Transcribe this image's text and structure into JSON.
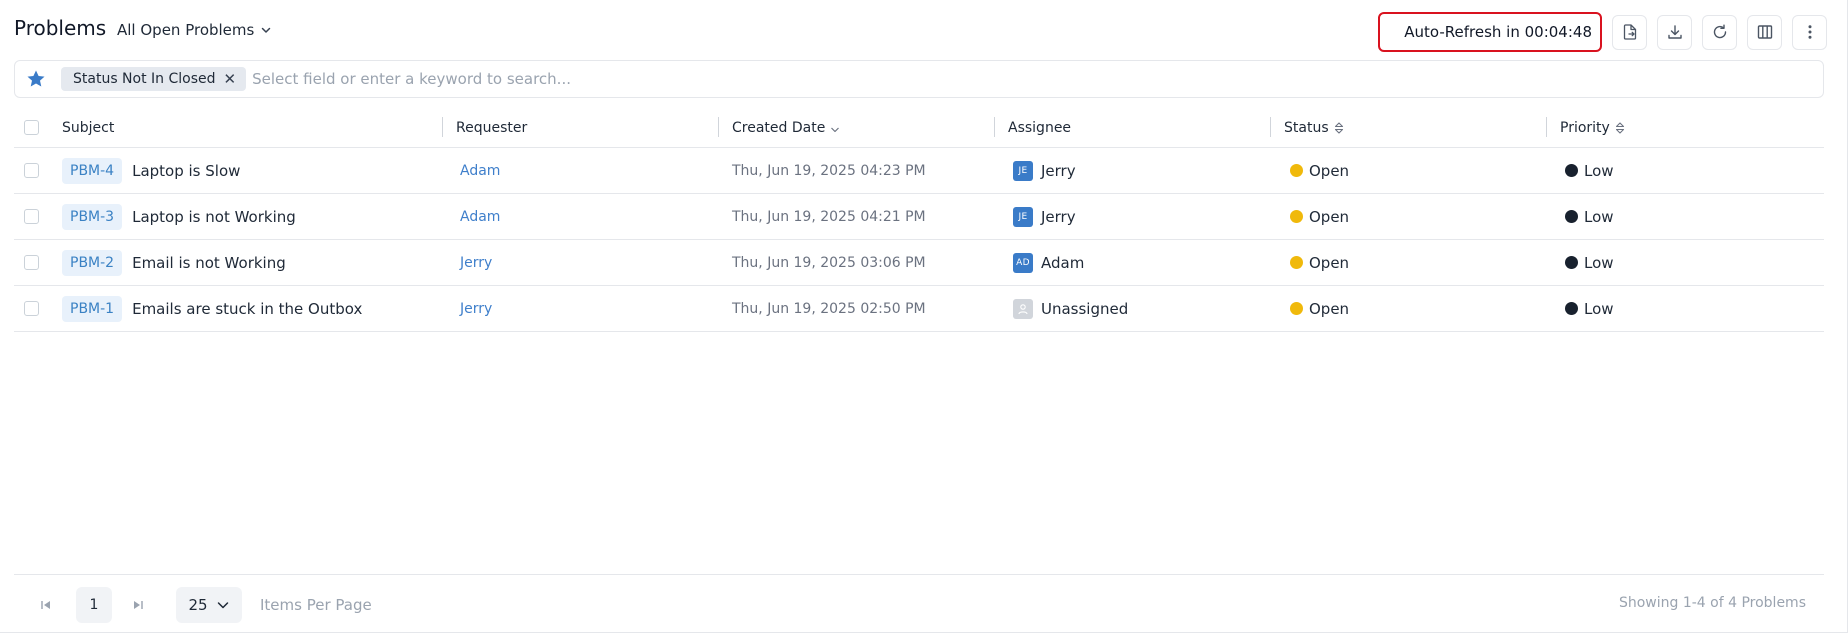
{
  "header": {
    "title": "Problems",
    "view": "All Open Problems",
    "auto_refresh": "Auto-Refresh in 00:04:48"
  },
  "toolbar": {
    "icons": [
      "export-icon",
      "download-icon",
      "refresh-icon",
      "columns-icon",
      "more-icon"
    ]
  },
  "search": {
    "filter_chip": "Status Not In Closed",
    "placeholder": "Select field or enter a keyword to search..."
  },
  "table": {
    "columns": [
      "Subject",
      "Requester",
      "Created Date",
      "Assignee",
      "Status",
      "Priority"
    ],
    "rows": [
      {
        "id": "PBM-4",
        "subject": "Laptop is Slow",
        "requester": "Adam",
        "created": "Thu, Jun 19, 2025 04:23 PM",
        "assignee_initials": "JE",
        "assignee": "Jerry",
        "status": "Open",
        "priority": "Low"
      },
      {
        "id": "PBM-3",
        "subject": "Laptop is not Working",
        "requester": "Adam",
        "created": "Thu, Jun 19, 2025 04:21 PM",
        "assignee_initials": "JE",
        "assignee": "Jerry",
        "status": "Open",
        "priority": "Low"
      },
      {
        "id": "PBM-2",
        "subject": "Email is not Working",
        "requester": "Jerry",
        "created": "Thu, Jun 19, 2025 03:06 PM",
        "assignee_initials": "AD",
        "assignee": "Adam",
        "status": "Open",
        "priority": "Low"
      },
      {
        "id": "PBM-1",
        "subject": "Emails are stuck in the Outbox",
        "requester": "Jerry",
        "created": "Thu, Jun 19, 2025 02:50 PM",
        "assignee_initials": "",
        "assignee": "Unassigned",
        "status": "Open",
        "priority": "Low"
      }
    ]
  },
  "footer": {
    "page": "1",
    "per_page": "25",
    "per_page_label": "Items Per Page",
    "showing": "Showing 1-4 of 4 Problems"
  },
  "colors": {
    "accent": "#3f7fcb",
    "status_open": "#f0b90b",
    "priority_low": "#18212e",
    "highlight_border": "#d9121f"
  }
}
